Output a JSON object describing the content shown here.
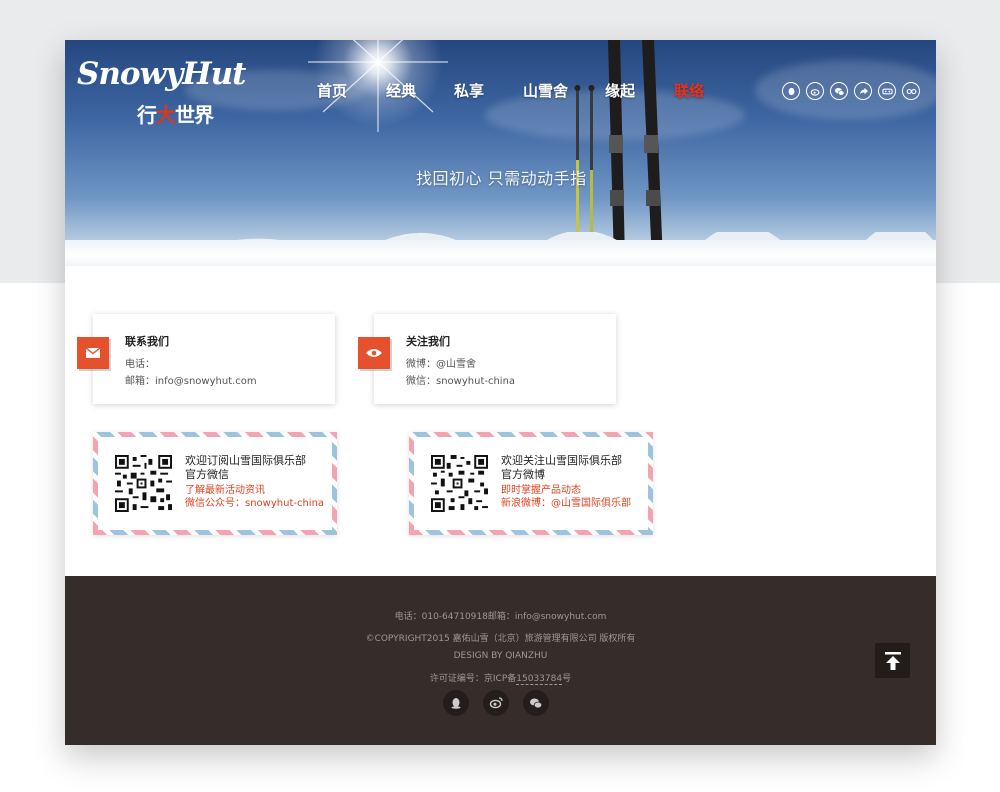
{
  "brand": {
    "logo_script": "SnowyHut",
    "logo_cn_pre": "行",
    "logo_cn_hl": "大",
    "logo_cn_post": "世界"
  },
  "nav": {
    "items": [
      {
        "label": "首页"
      },
      {
        "label": "经典"
      },
      {
        "label": "私享"
      },
      {
        "label": "山雪舍"
      },
      {
        "label": "缘起"
      },
      {
        "label": "联络"
      }
    ],
    "active_index": 5
  },
  "social_icons": [
    "qq-icon",
    "weibo-icon",
    "wechat-icon",
    "share-icon",
    "vr-icon",
    "glasses-icon"
  ],
  "hero": {
    "slogan": "找回初心 只需动动手指"
  },
  "contact_cards": [
    {
      "title": "联系我们",
      "icon": "envelope-icon",
      "line1": "电话：",
      "line2": "邮箱：info@snowyhut.com"
    },
    {
      "title": "关注我们",
      "icon": "eye-icon",
      "line1": "微博：@山雪舍",
      "line2": "微信：snowyhut-china"
    }
  ],
  "stamps": [
    {
      "line1": "欢迎订阅山雪国际俱乐部",
      "line2": "官方微信",
      "red1": "了解最新活动资讯",
      "red2": "微信公众号：snowyhut-china"
    },
    {
      "line1": "欢迎关注山雪国际俱乐部",
      "line2": "官方微博",
      "red1": "即时掌握产品动态",
      "red2": "新浪微博：@山雪国际俱乐部"
    }
  ],
  "footer": {
    "contact": "电话：010-64710918邮箱：info@snowyhut.com",
    "copyright": "©COPYRIGHT2015  嘉佑山雪（北京）旅游管理有限公司 版权所有",
    "design": "DESIGN    BY    QIANZHU",
    "license_prefix": "许可证编号：京ICP备",
    "license_number": "15033784",
    "license_suffix": "号"
  },
  "colors": {
    "accent": "#e6512d",
    "nav_active": "#e7321b",
    "footer_bg": "#362c2a"
  }
}
